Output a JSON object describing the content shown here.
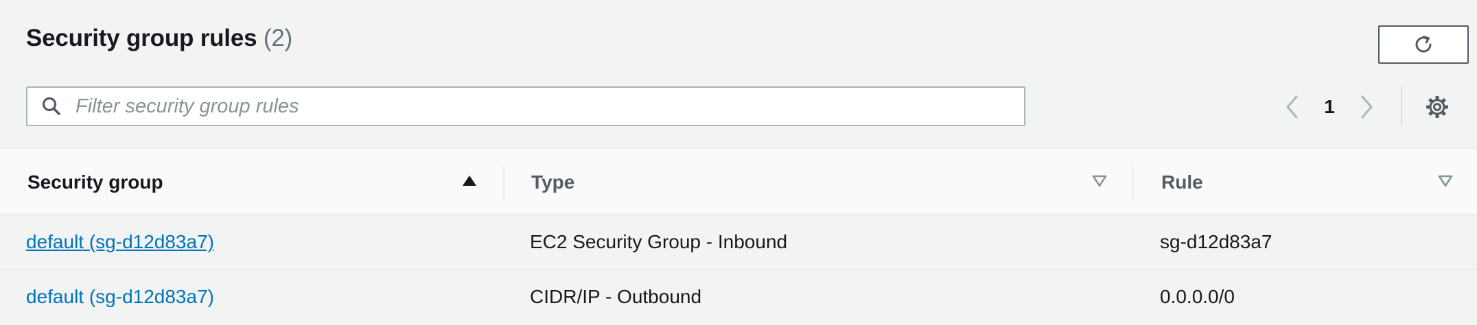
{
  "header": {
    "title": "Security group rules",
    "count": "(2)"
  },
  "search": {
    "placeholder": "Filter security group rules",
    "value": ""
  },
  "pagination": {
    "current_page": "1"
  },
  "table": {
    "columns": [
      {
        "label": "Security group",
        "sort": "ascending"
      },
      {
        "label": "Type",
        "sort": "none"
      },
      {
        "label": "Rule",
        "sort": "none"
      }
    ],
    "rows": [
      {
        "security_group": "default (sg-d12d83a7)",
        "type": "EC2 Security Group - Inbound",
        "rule": "sg-d12d83a7"
      },
      {
        "security_group": "default (sg-d12d83a7)",
        "type": "CIDR/IP - Outbound",
        "rule": "0.0.0.0/0"
      }
    ]
  },
  "colors": {
    "link": "#0073bb",
    "background": "#f2f3f3",
    "text": "#16191f",
    "muted": "#687078",
    "border": "#aab7b8"
  },
  "icons": [
    "refresh-icon",
    "search-icon",
    "chevron-left-icon",
    "chevron-right-icon",
    "gear-icon",
    "sort-ascending-icon",
    "sort-unsorted-icon"
  ]
}
